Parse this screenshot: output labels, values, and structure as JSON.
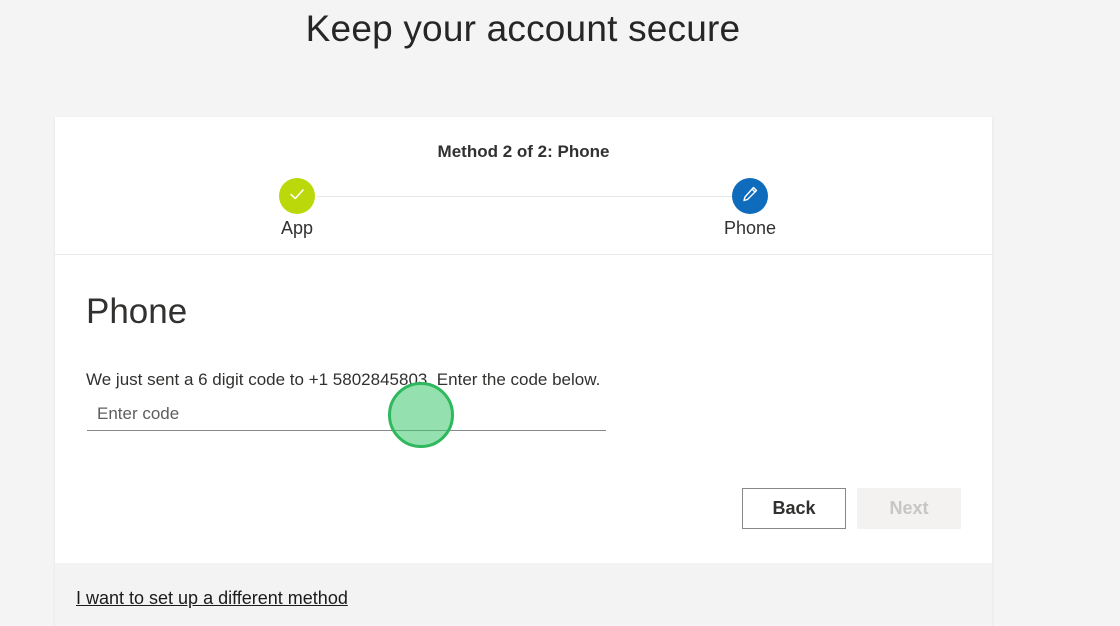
{
  "page": {
    "title": "Keep your account secure"
  },
  "progress": {
    "method_label": "Method 2 of 2: Phone",
    "steps": [
      {
        "label": "App",
        "state": "complete",
        "icon": "checkmark-icon",
        "color": "#bad80a"
      },
      {
        "label": "Phone",
        "state": "current",
        "icon": "pencil-icon",
        "color": "#0f6cbd"
      }
    ]
  },
  "main": {
    "section_title": "Phone",
    "instruction": "We just sent a 6 digit code to +1 5802845803. Enter the code below.",
    "code_input": {
      "value": "",
      "placeholder": "Enter code"
    },
    "buttons": {
      "back": "Back",
      "next": "Next"
    }
  },
  "footer": {
    "different_method_link": "I want to set up a different method"
  },
  "colors": {
    "accent": "#0f6cbd",
    "success": "#bad80a",
    "cursor_highlight": "#2fb85e"
  }
}
